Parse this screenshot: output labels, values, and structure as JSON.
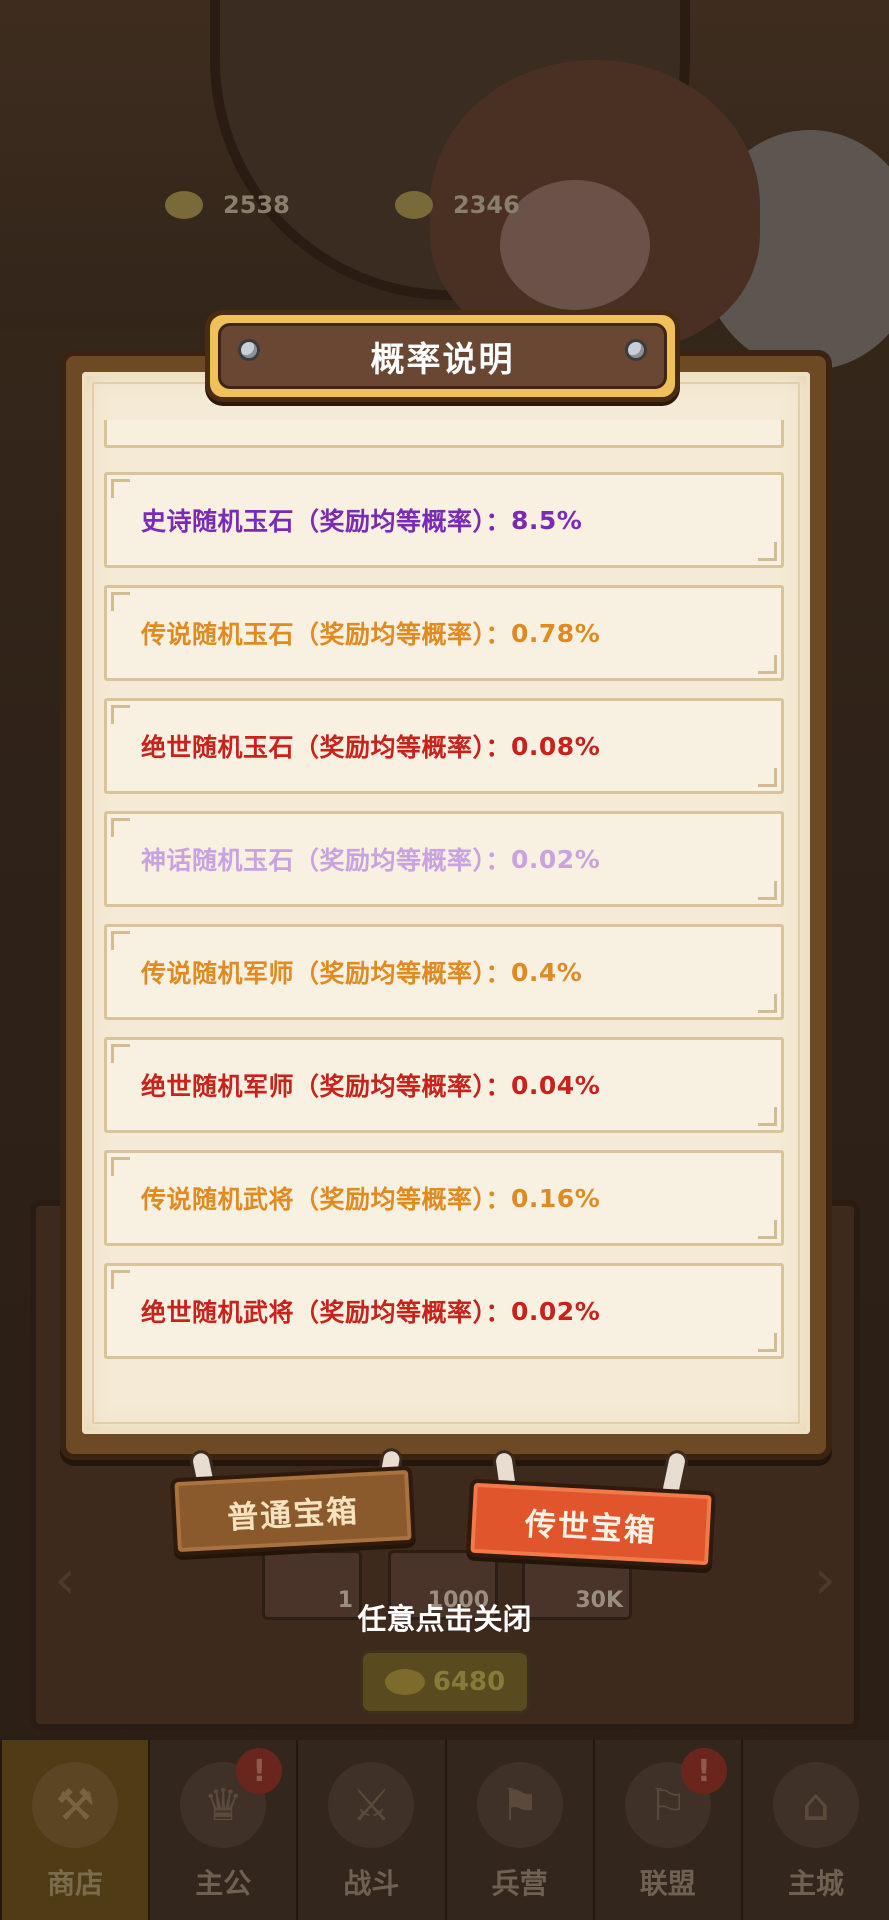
{
  "currency": {
    "gold": "2538",
    "coins": "2346"
  },
  "modal": {
    "title": "概率说明",
    "rows": [
      {
        "label": "史诗随机玉石（奖励均等概率）：",
        "value": "8.5%",
        "color": "#7a2ab5"
      },
      {
        "label": "传说随机玉石（奖励均等概率）：",
        "value": "0.78%",
        "color": "#e08a22"
      },
      {
        "label": "绝世随机玉石（奖励均等概率）：",
        "value": "0.08%",
        "color": "#c8221c"
      },
      {
        "label": "神话随机玉石（奖励均等概率）：",
        "value": "0.02%",
        "color": "#c9a2e0"
      },
      {
        "label": "传说随机军师（奖励均等概率）：",
        "value": "0.4%",
        "color": "#e08a22"
      },
      {
        "label": "绝世随机军师（奖励均等概率）：",
        "value": "0.04%",
        "color": "#c8221c"
      },
      {
        "label": "传说随机武将（奖励均等概率）：",
        "value": "0.16%",
        "color": "#e08a22"
      },
      {
        "label": "绝世随机武将（奖励均等概率）：",
        "value": "0.02%",
        "color": "#c8221c"
      }
    ]
  },
  "tabs": {
    "normal": "普通宝箱",
    "legend": "传世宝箱"
  },
  "close_hint": "任意点击关闭",
  "shop_bg": {
    "card_1": "1",
    "card_2": "1000",
    "card_3": "30K",
    "price": "6480"
  },
  "nav": [
    {
      "label": "商店",
      "icon": "shop-icon",
      "active": true
    },
    {
      "label": "主公",
      "icon": "lord-icon",
      "badge": "!"
    },
    {
      "label": "战斗",
      "icon": "battle-icon"
    },
    {
      "label": "兵营",
      "icon": "barracks-icon"
    },
    {
      "label": "联盟",
      "icon": "alliance-icon",
      "badge": "!"
    },
    {
      "label": "主城",
      "icon": "city-icon"
    }
  ]
}
